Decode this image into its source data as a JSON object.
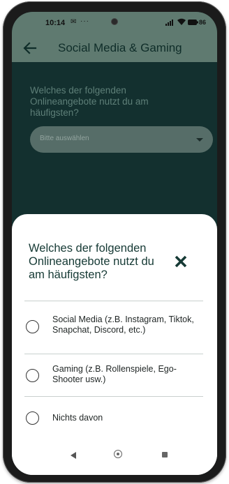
{
  "status_bar": {
    "time": "10:14",
    "notification_glyph": "✉",
    "overflow": "···",
    "battery": "86"
  },
  "app_bar": {
    "title": "Social Media & Gaming",
    "back_icon": "arrow-left-icon"
  },
  "question": {
    "text": "Welches der folgenden Onlineangebote nutzt du am häufigsten?",
    "select_placeholder": "Bitte auswählen"
  },
  "sheet": {
    "title": "Welches der folgenden Onlineangebote nutzt du am häufigsten?",
    "close_icon": "close-icon",
    "options": [
      {
        "label": "Social Media (z.B. Instagram, Tiktok, Snapchat, Discord, etc.)",
        "selected": false
      },
      {
        "label": "Gaming (z.B. Rollenspiele, Ego-Shooter usw.)",
        "selected": false
      },
      {
        "label": "Nichts davon",
        "selected": false
      }
    ]
  },
  "colors": {
    "app_bar": "#5f7a70",
    "background": "#13302f",
    "accent_text": "#163a35"
  }
}
